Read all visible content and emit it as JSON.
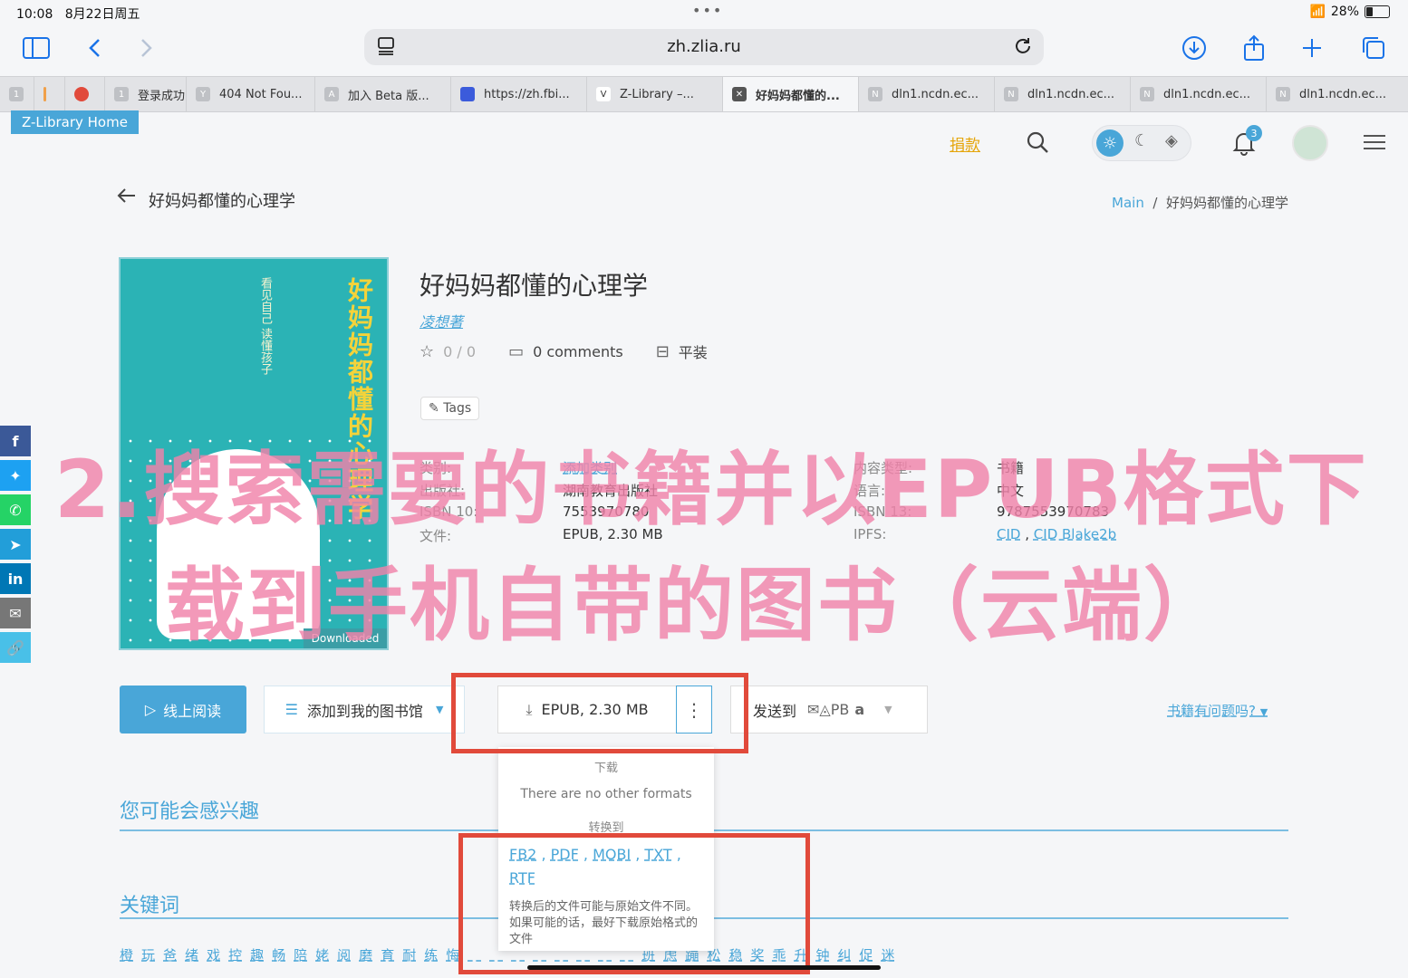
{
  "status": {
    "time": "10:08",
    "date": "8月22日周五",
    "battery": "28%"
  },
  "browser": {
    "url": "zh.zlia.ru",
    "tabs": [
      {
        "fav": "1",
        "label": ""
      },
      {
        "fav": "",
        "label": ""
      },
      {
        "fav": "",
        "label": ""
      },
      {
        "fav": "1",
        "label": "登录成功"
      },
      {
        "fav": "Y",
        "label": "404 Not Fou..."
      },
      {
        "fav": "A",
        "label": "加入 Beta 版..."
      },
      {
        "fav": "",
        "label": "https://zh.fbi..."
      },
      {
        "fav": "V",
        "label": "Z-Library –..."
      },
      {
        "fav": "✕",
        "label": "好妈妈都懂的..."
      },
      {
        "fav": "N",
        "label": "dln1.ncdn.ec..."
      },
      {
        "fav": "N",
        "label": "dln1.ncdn.ec..."
      },
      {
        "fav": "N",
        "label": "dln1.ncdn.ec..."
      },
      {
        "fav": "N",
        "label": "dln1.ncdn.ec..."
      }
    ]
  },
  "site": {
    "home_label": "Z-Library Home",
    "donate": "捐款",
    "notif_count": "3"
  },
  "breadcrumb": {
    "title": "好妈妈都懂的心理学",
    "main": "Main",
    "sep": "/",
    "current": "好妈妈都懂的心理学"
  },
  "cover": {
    "title": "好妈妈都懂的心理学",
    "subtitle": "看见自己 读懂孩子",
    "badge": "Downloaded"
  },
  "book": {
    "title": "好妈妈都懂的心理学",
    "author": "凌想著",
    "rating": "0 / 0",
    "comments": "0 comments",
    "binding": "平装",
    "tags": "Tags",
    "info": {
      "category_label": "类别:",
      "category_value": "添加类别",
      "publisher_label": "出版社:",
      "publisher_value": "湖南教育出版社",
      "isbn10_label": "ISBN 10:",
      "isbn10_value": "7553970780",
      "file_label": "文件:",
      "file_value": "EPUB, 2.30 MB",
      "content_label": "内容类型:",
      "content_value": "书籍",
      "lang_label": "语言:",
      "lang_value": "中文",
      "isbn13_label": "ISBN 13:",
      "isbn13_value": "9787553970783",
      "ipfs_label": "IPFS:",
      "ipfs_cid": "CID",
      "ipfs_sep": ",",
      "ipfs_blake": "CID Blake2b"
    }
  },
  "overlay": {
    "line1": "2.搜索需要的书籍并以EPUB格式下",
    "line2": "载到手机自带的图书（云端）"
  },
  "actions": {
    "read": "线上阅读",
    "add_library": "添加到我的图书馆",
    "epub": "EPUB, 2.30 MB",
    "send_to": "发送到",
    "send_pb": "PB",
    "problem": "书籍有问题吗?"
  },
  "dropdown": {
    "download_header": "下载",
    "no_formats": "There are no other formats",
    "convert_header": "转换到",
    "formats": [
      "FB2",
      "PDF",
      "MOBI",
      "TXT",
      "RTF"
    ],
    "warning": "转换后的文件可能与原始文件不同。如果可能的话，最好下载原始格式的文件"
  },
  "sections": {
    "interest": "您可能会感兴趣",
    "keywords": "关键词"
  },
  "keywords": [
    "橙",
    "玩",
    "爸",
    "绪",
    "戏",
    "控",
    "趣",
    "畅",
    "陪",
    "姥",
    "阅",
    "磨",
    "育",
    "耐",
    "练",
    "悔",
    "",
    "",
    "",
    "",
    "",
    "",
    "",
    "",
    "班",
    "虑",
    "蹦",
    "松",
    "稳",
    "奖",
    "乖",
    "升",
    "钟",
    "纠",
    "促",
    "迷"
  ],
  "colors": {
    "accent": "#49a6d8",
    "overlay": "#f082aa",
    "highlight_box": "#e14a3b",
    "donate": "#e5a50a"
  }
}
